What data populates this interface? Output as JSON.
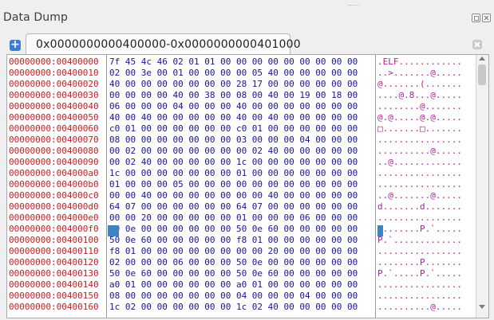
{
  "panel": {
    "title": "Data Dump"
  },
  "tabs": {
    "active_label": "0x0000000000400000-0x0000000000401000"
  },
  "dump": {
    "addresses": [
      "00000000:00400000",
      "00000000:00400010",
      "00000000:00400020",
      "00000000:00400030",
      "00000000:00400040",
      "00000000:00400050",
      "00000000:00400060",
      "00000000:00400070",
      "00000000:00400080",
      "00000000:00400090",
      "00000000:004000a0",
      "00000000:004000b0",
      "00000000:004000c0",
      "00000000:004000d0",
      "00000000:004000e0",
      "00000000:004000f0",
      "00000000:00400100",
      "00000000:00400110",
      "00000000:00400120",
      "00000000:00400130",
      "00000000:00400140",
      "00000000:00400150",
      "00000000:00400160"
    ],
    "hex": [
      "7f 45 4c 46 02 01 01 00 00 00 00 00 00 00 00 00",
      "02 00 3e 00 01 00 00 00 00 05 40 00 00 00 00 00",
      "40 00 00 00 00 00 00 00 28 17 00 00 00 00 00 00",
      "00 00 00 00 40 00 38 00 08 00 40 00 19 00 18 00",
      "06 00 00 00 04 00 00 00 40 00 00 00 00 00 00 00",
      "40 00 40 00 00 00 00 00 40 00 40 00 00 00 00 00",
      "c0 01 00 00 00 00 00 00 c0 01 00 00 00 00 00 00",
      "08 00 00 00 00 00 00 00 03 00 00 00 04 00 00 00",
      "00 02 00 00 00 00 00 00 00 02 40 00 00 00 00 00",
      "00 02 40 00 00 00 00 00 1c 00 00 00 00 00 00 00",
      "1c 00 00 00 00 00 00 00 01 00 00 00 00 00 00 00",
      "01 00 00 00 05 00 00 00 00 00 00 00 00 00 00 00",
      "00 00 40 00 00 00 00 00 00 00 40 00 00 00 00 00",
      "64 07 00 00 00 00 00 00 64 07 00 00 00 00 00 00",
      "00 00 20 00 00 00 00 00 01 00 00 00 06 00 00 00",
      "50 0e 00 00 00 00 00 00 50 0e 60 00 00 00 00 00",
      "50 0e 60 00 00 00 00 00 f8 01 00 00 00 00 00 00",
      "f8 01 00 00 00 00 00 00 00 00 20 00 00 00 00 00",
      "02 00 00 00 06 00 00 00 50 0e 00 00 00 00 00 00",
      "50 0e 60 00 00 00 00 00 50 0e 60 00 00 00 00 00",
      "a0 01 00 00 00 00 00 00 a0 01 00 00 00 00 00 00",
      "08 00 00 00 00 00 00 00 04 00 00 00 04 00 00 00",
      "1c 02 00 00 00 00 00 00 1c 02 40 00 00 00 00 00"
    ],
    "ascii": [
      ".ELF............",
      "..>.......@.....",
      "@.......(.......",
      "....@.8...@.....",
      "........@.......",
      "@.@.....@.@.....",
      "□.......□.......",
      "................",
      "..........@.....",
      "..@.............",
      "................",
      "................",
      "..@.......@.....",
      "d.......d.......",
      "................",
      "P.......P.`.....",
      "P.`.............",
      "................",
      "........P.......",
      "P.`.....P.`.....",
      "................",
      "................",
      "..........@....."
    ]
  }
}
